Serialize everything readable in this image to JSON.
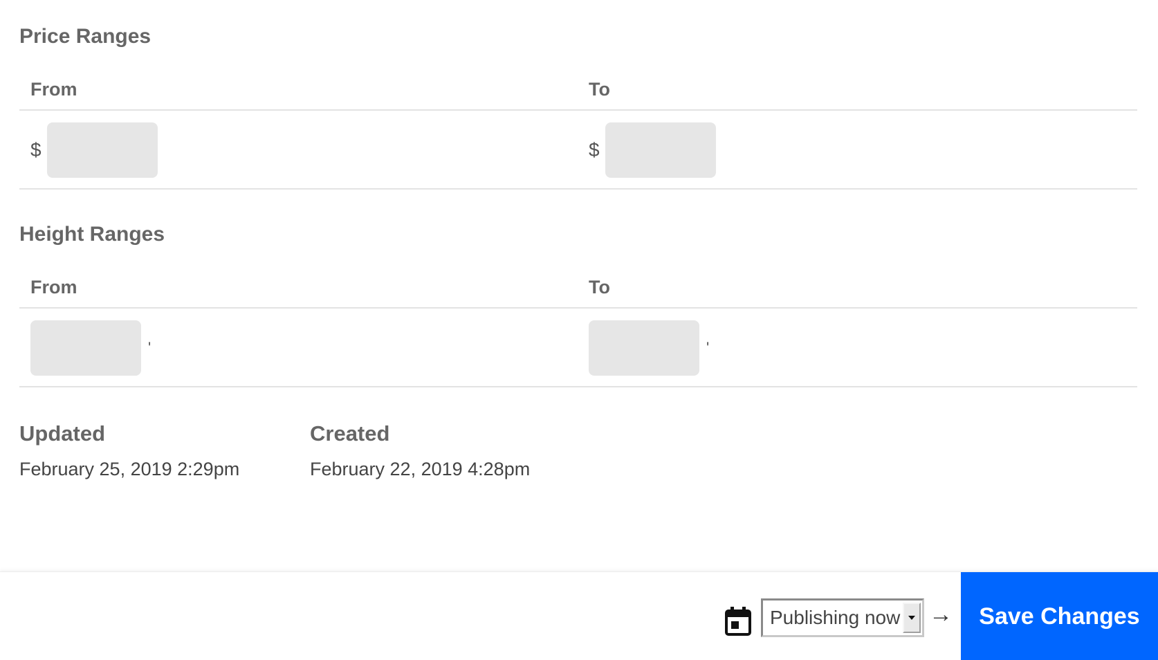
{
  "price_ranges": {
    "title": "Price Ranges",
    "from_header": "From",
    "to_header": "To",
    "currency_symbol": "$",
    "from_value": "",
    "to_value": ""
  },
  "height_ranges": {
    "title": "Height Ranges",
    "from_header": "From",
    "to_header": "To",
    "unit_symbol": "'",
    "from_value": "",
    "to_value": ""
  },
  "meta": {
    "updated_label": "Updated",
    "updated_value": "February 25, 2019 2:29pm",
    "created_label": "Created",
    "created_value": "February 22, 2019 4:28pm"
  },
  "footer": {
    "calendar_icon": "calendar-icon",
    "publish_select_value": "Publishing now",
    "arrow_glyph": "→",
    "save_label": "Save Changes",
    "save_color": "#0066ff"
  }
}
